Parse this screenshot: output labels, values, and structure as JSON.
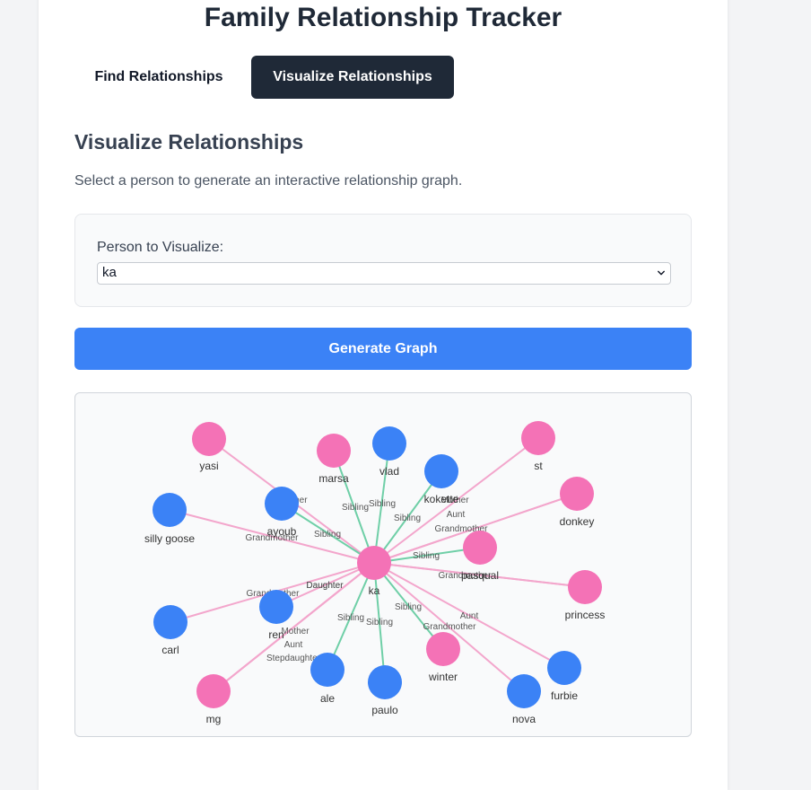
{
  "app": {
    "title": "Family Relationship Tracker"
  },
  "tabs": [
    {
      "label": "Find Relationships",
      "active": false
    },
    {
      "label": "Visualize Relationships",
      "active": true
    }
  ],
  "section": {
    "title": "Visualize Relationships",
    "description": "Select a person to generate an interactive relationship graph."
  },
  "person_select": {
    "label": "Person to Visualize:",
    "value": "ka"
  },
  "generate_button": {
    "label": "Generate Graph"
  },
  "colors": {
    "male_node": "#3b82f6",
    "female_node": "#f472b6",
    "sibling_edge": "#6fcfa7",
    "other_edge": "#f3a6cc",
    "dark_tab": "#1f2937",
    "primary_button": "#3b82f6"
  },
  "graph": {
    "center": {
      "id": "ka",
      "label": "ka",
      "gender": "female"
    },
    "nodes": [
      {
        "id": "yasi",
        "label": "yasi",
        "gender": "female"
      },
      {
        "id": "marsa",
        "label": "marsa",
        "gender": "female"
      },
      {
        "id": "vlad",
        "label": "vlad",
        "gender": "male"
      },
      {
        "id": "kokette",
        "label": "kokette",
        "gender": "male"
      },
      {
        "id": "st",
        "label": "st",
        "gender": "female"
      },
      {
        "id": "silly-goose",
        "label": "silly goose",
        "gender": "male"
      },
      {
        "id": "ayoub",
        "label": "ayoub",
        "gender": "male"
      },
      {
        "id": "donkey",
        "label": "donkey",
        "gender": "female"
      },
      {
        "id": "pasqual",
        "label": "pasqual",
        "gender": "female"
      },
      {
        "id": "princess",
        "label": "princess",
        "gender": "female"
      },
      {
        "id": "carl",
        "label": "carl",
        "gender": "male"
      },
      {
        "id": "ren",
        "label": "ren",
        "gender": "male"
      },
      {
        "id": "winter",
        "label": "winter",
        "gender": "female"
      },
      {
        "id": "furbie",
        "label": "furbie",
        "gender": "male"
      },
      {
        "id": "mg",
        "label": "mg",
        "gender": "female"
      },
      {
        "id": "ale",
        "label": "ale",
        "gender": "male"
      },
      {
        "id": "paulo",
        "label": "paulo",
        "gender": "male"
      },
      {
        "id": "nova",
        "label": "nova",
        "gender": "male"
      }
    ],
    "edges": [
      {
        "to": "yasi",
        "type": "other",
        "label": "Mother"
      },
      {
        "to": "marsa",
        "type": "sibling",
        "label": "Sibling"
      },
      {
        "to": "vlad",
        "type": "sibling",
        "label": "Sibling"
      },
      {
        "to": "kokette",
        "type": "sibling",
        "label": "Sibling"
      },
      {
        "to": "st",
        "type": "other",
        "label": "Mother"
      },
      {
        "to": "silly-goose",
        "type": "other",
        "label": "Grandmother"
      },
      {
        "to": "ayoub",
        "type": "sibling",
        "label": "Sibling"
      },
      {
        "to": "donkey",
        "type": "other",
        "label": "Aunt"
      },
      {
        "to": "donkey",
        "type": "other",
        "label": "Grandmother"
      },
      {
        "to": "pasqual",
        "type": "sibling",
        "label": "Sibling"
      },
      {
        "to": "princess",
        "type": "other",
        "label": "Grandmother"
      },
      {
        "to": "princess",
        "type": "other",
        "label": "Daughter"
      },
      {
        "to": "carl",
        "type": "other",
        "label": "Grandmother"
      },
      {
        "to": "ren",
        "type": "other",
        "label": "Daughter"
      },
      {
        "to": "mg",
        "type": "other",
        "label": "Mother"
      },
      {
        "to": "mg",
        "type": "other",
        "label": "Aunt"
      },
      {
        "to": "mg",
        "type": "other",
        "label": "Stepdaughter"
      },
      {
        "to": "ale",
        "type": "sibling",
        "label": "Sibling"
      },
      {
        "to": "paulo",
        "type": "sibling",
        "label": "Sibling"
      },
      {
        "to": "winter",
        "type": "sibling",
        "label": "Sibling"
      },
      {
        "to": "nova",
        "type": "other",
        "label": "Grandmother"
      },
      {
        "to": "furbie",
        "type": "other",
        "label": "Aunt"
      }
    ]
  }
}
